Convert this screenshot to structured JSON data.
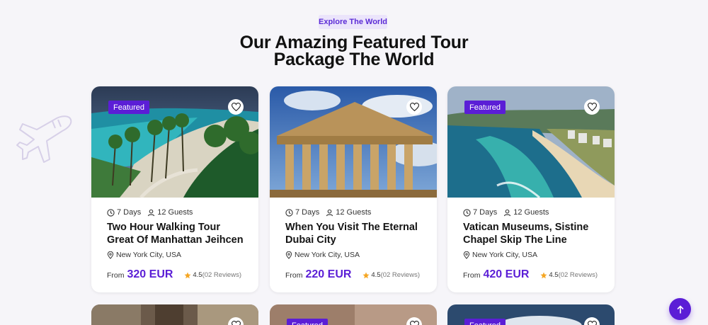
{
  "section": {
    "eyebrow": "Explore The World",
    "title": "Our Amazing Featured Tour Package The World"
  },
  "cards": [
    {
      "featured_label": "Featured",
      "days": "7 Days",
      "guests": "12 Guests",
      "title": "Two Hour Walking Tour Great Of Manhattan Jeihcen",
      "location": "New York City, USA",
      "from_label": "From",
      "price": "320 EUR",
      "rating": "4.5",
      "reviews": "(02 Reviews)"
    },
    {
      "days": "7 Days",
      "guests": "12 Guests",
      "title": "When You Visit The Eternal Dubai City",
      "location": "New York City, USA",
      "from_label": "From",
      "price": "220 EUR",
      "rating": "4.5",
      "reviews": "(02 Reviews)"
    },
    {
      "featured_label": "Featured",
      "days": "7 Days",
      "guests": "12 Guests",
      "title": "Vatican Museums, Sistine Chapel Skip The Line",
      "location": "New York City, USA",
      "from_label": "From",
      "price": "420 EUR",
      "rating": "4.5",
      "reviews": "(02 Reviews)"
    }
  ],
  "next_row": [
    {},
    {
      "featured_label": "Featured"
    },
    {
      "featured_label": "Featured"
    }
  ],
  "colors": {
    "accent": "#5b1ed6",
    "eyebrow_bg": "#ebe4fb",
    "star": "#f5a623",
    "page_bg": "#f6f5f9"
  },
  "icons": [
    "plane-icon",
    "heart-icon",
    "clock-icon",
    "user-icon",
    "location-pin-icon",
    "star-icon",
    "arrow-up-icon"
  ]
}
